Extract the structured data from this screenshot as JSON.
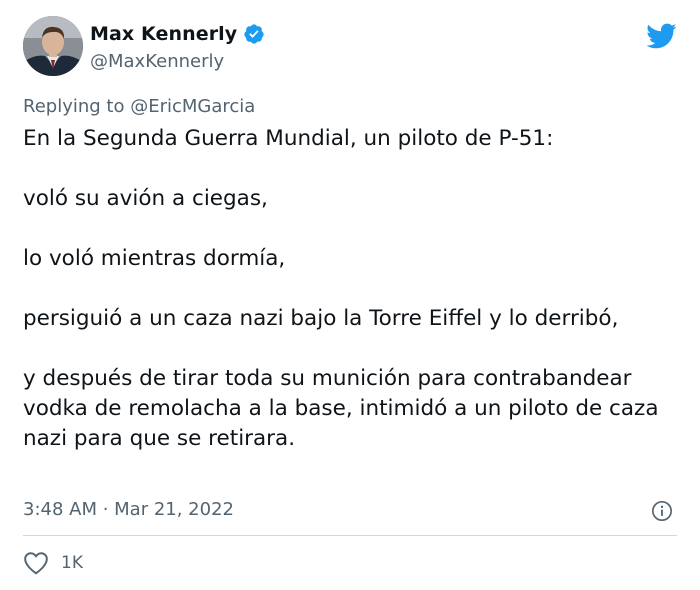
{
  "tweet": {
    "author": {
      "display_name": "Max Kennerly",
      "handle": "@MaxKennerly",
      "verified": true
    },
    "reply_prefix": "Replying to",
    "reply_to": "@EricMGarcia",
    "paragraphs": [
      "En la Segunda Guerra Mundial, un piloto de P-51:",
      "voló su avión a ciegas,",
      "lo voló mientras dormía,",
      "persiguió a un caza nazi bajo la Torre Eiffel y lo derribó,",
      "y después de tirar toda su munición para contrabandear vodka de remolacha a la base, intimidó a un piloto de caza nazi para que se retirara."
    ],
    "timestamp": "3:48 AM · Mar 21, 2022",
    "likes": "1K"
  },
  "icons": {
    "brand": "twitter-bird-icon",
    "verified": "verified-badge-icon",
    "info": "info-icon",
    "like": "heart-icon"
  },
  "colors": {
    "twitter_blue": "#1d9bf0",
    "text_primary": "#0f1419",
    "text_secondary": "#536471",
    "divider": "#cfd9de"
  }
}
